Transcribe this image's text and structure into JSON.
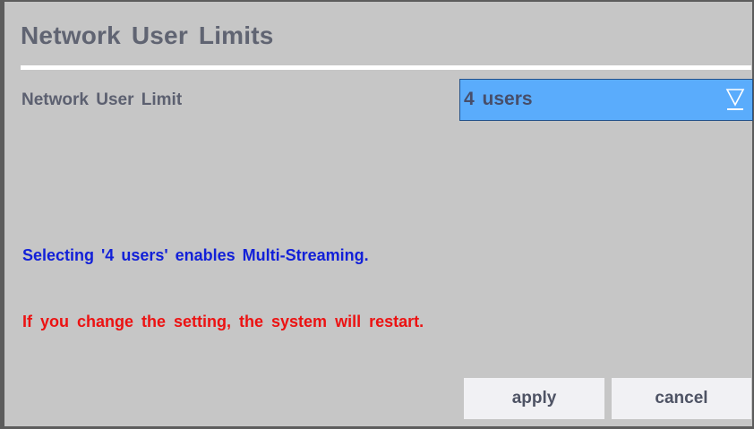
{
  "dialog": {
    "title": "Network User Limits"
  },
  "setting": {
    "label": "Network User Limit",
    "selected_value": "4 users",
    "arrow_icon": "dropdown-triangle-icon"
  },
  "messages": {
    "info": "Selecting '4 users' enables Multi-Streaming.",
    "warning": "If you change the setting, the system will restart."
  },
  "buttons": {
    "apply_label": "apply",
    "cancel_label": "cancel"
  },
  "colors": {
    "background": "#c6c6c6",
    "select_fill": "#5aacfc",
    "info_text": "#1220d8",
    "warning_text": "#ec1212",
    "button_fill": "#f1f1f4"
  }
}
